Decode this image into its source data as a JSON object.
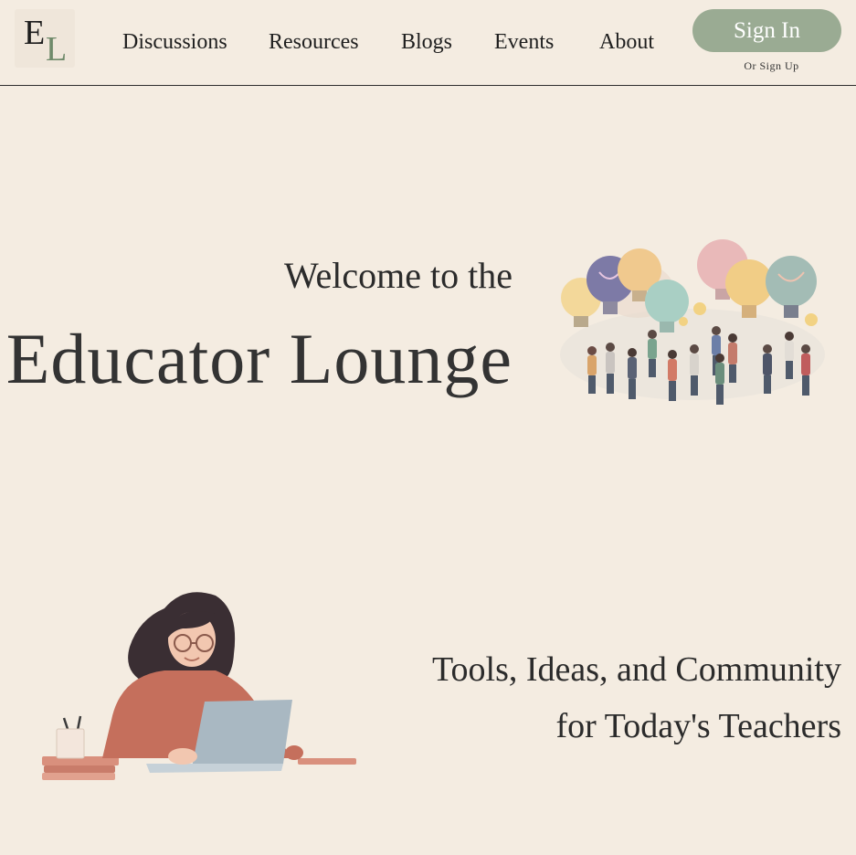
{
  "header": {
    "logo": {
      "letter1": "E",
      "letter2": "L"
    },
    "nav": [
      {
        "label": "Discussions"
      },
      {
        "label": "Resources"
      },
      {
        "label": "Blogs"
      },
      {
        "label": "Events"
      },
      {
        "label": "About"
      }
    ],
    "signin_label": "Sign In",
    "signup_label": "Or Sign Up"
  },
  "hero": {
    "welcome": "Welcome to the",
    "title": "Educator Lounge"
  },
  "section2": {
    "tagline_line1": "Tools, Ideas, and Community",
    "tagline_line2": "for Today's Teachers"
  },
  "colors": {
    "background": "#f4ece1",
    "accent": "#9aab93",
    "logo_green": "#6f8a6a",
    "text": "#2b2b2b"
  }
}
